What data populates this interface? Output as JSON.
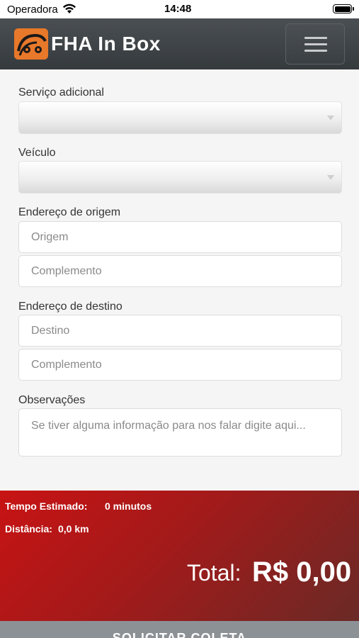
{
  "status_bar": {
    "carrier": "Operadora",
    "time": "14:48"
  },
  "header": {
    "brand": "FHA In Box",
    "brand_color": "#e8782a",
    "icons": [
      "wifi-icon",
      "battery-icon",
      "hamburger-menu-icon"
    ]
  },
  "form": {
    "service_label": "Serviço adicional",
    "service_value": "",
    "vehicle_label": "Veículo",
    "vehicle_value": "",
    "origin_label": "Endereço de origem",
    "origin_placeholder": "Origem",
    "origin_complement_placeholder": "Complemento",
    "destination_label": "Endereço de destino",
    "destination_placeholder": "Destino",
    "destination_complement_placeholder": "Complemento",
    "notes_label": "Observações",
    "notes_placeholder": "Se tiver alguma informação para nos falar digite aqui..."
  },
  "summary": {
    "time_label": "Tempo Estimado:",
    "time_value": "0 minutos",
    "distance_label": "Distância:",
    "distance_value": "0,0 km",
    "total_label": "Total:",
    "total_value": "R$ 0,00",
    "accent_color": "#c81314"
  },
  "submit": {
    "label": "SOLICITAR COLETA"
  }
}
